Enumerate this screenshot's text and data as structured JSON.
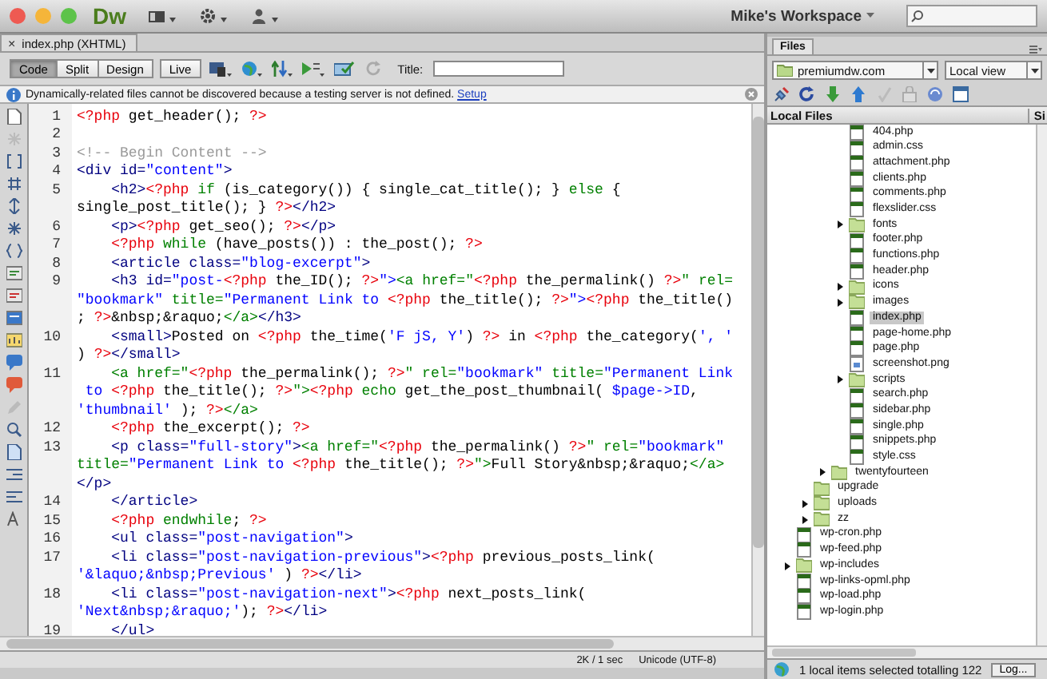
{
  "window": {
    "app_logo": "Dw",
    "workspace": "Mike's Workspace"
  },
  "document_tab": {
    "close": "×",
    "label": "index.php (XHTML)"
  },
  "view_buttons": [
    {
      "label": "Code",
      "selected": true
    },
    {
      "label": "Split",
      "selected": false
    },
    {
      "label": "Design",
      "selected": false
    },
    {
      "label": "Live",
      "selected": false
    }
  ],
  "title_field": {
    "label": "Title:"
  },
  "info_bar": {
    "message": "Dynamically-related files cannot be discovered because a testing server is not defined.",
    "link": "Setup"
  },
  "code": {
    "lines": [
      {
        "number": "1",
        "indent": false,
        "tokens": [
          {
            "kind": "php",
            "text": "<?php"
          },
          {
            "kind": "txt",
            "text": " get_header(); "
          },
          {
            "kind": "php",
            "text": "?>"
          }
        ]
      },
      {
        "number": "2"
      },
      {
        "number": "3",
        "indent": false,
        "tokens": [
          {
            "kind": "cmt",
            "text": "<!-- Begin Content -->"
          }
        ]
      },
      {
        "number": "4",
        "indent": false,
        "tokens": [
          {
            "kind": "tag",
            "text": "<div id="
          },
          {
            "kind": "str",
            "text": "\"content\""
          },
          {
            "kind": "tag",
            "text": ">"
          }
        ]
      },
      {
        "number": "5",
        "indent": true,
        "tokens": [
          {
            "kind": "tag",
            "text": "<h2>"
          },
          {
            "kind": "php",
            "text": "<?php "
          },
          {
            "kind": "kw",
            "text": "if"
          },
          {
            "kind": "txt",
            "text": " (is_category()) { single_cat_title(); } "
          },
          {
            "kind": "kw",
            "text": "else"
          },
          {
            "kind": "txt",
            "text": " {"
          }
        ]
      },
      {
        "indent": false,
        "tokens": [
          {
            "kind": "txt",
            "text": "single_post_title(); } "
          },
          {
            "kind": "php",
            "text": "?>"
          },
          {
            "kind": "tag",
            "text": "</h2>"
          }
        ]
      },
      {
        "number": "6",
        "indent": true,
        "tokens": [
          {
            "kind": "tag",
            "text": "<p>"
          },
          {
            "kind": "php",
            "text": "<?php"
          },
          {
            "kind": "txt",
            "text": " get_seo(); "
          },
          {
            "kind": "php",
            "text": "?>"
          },
          {
            "kind": "tag",
            "text": "</p>"
          }
        ]
      },
      {
        "number": "7",
        "indent": true,
        "tokens": [
          {
            "kind": "php",
            "text": "<?php "
          },
          {
            "kind": "kw",
            "text": "while"
          },
          {
            "kind": "txt",
            "text": " (have_posts()) : the_post(); "
          },
          {
            "kind": "php",
            "text": "?>"
          }
        ]
      },
      {
        "number": "8",
        "indent": true,
        "tokens": [
          {
            "kind": "tag",
            "text": "<article class="
          },
          {
            "kind": "str",
            "text": "\"blog-excerpt\""
          },
          {
            "kind": "tag",
            "text": ">"
          }
        ]
      },
      {
        "number": "9",
        "indent": true,
        "tokens": [
          {
            "kind": "tag",
            "text": "<h3 id="
          },
          {
            "kind": "str",
            "text": "\"post-"
          },
          {
            "kind": "php",
            "text": "<?php"
          },
          {
            "kind": "txt",
            "text": " the_ID(); "
          },
          {
            "kind": "php",
            "text": "?>"
          },
          {
            "kind": "str",
            "text": "\">"
          },
          {
            "kind": "kw",
            "text": "<a href=\""
          },
          {
            "kind": "php",
            "text": "<?php"
          },
          {
            "kind": "txt",
            "text": " the_permalink() "
          },
          {
            "kind": "php",
            "text": "?>"
          },
          {
            "kind": "kw",
            "text": "\" rel="
          }
        ]
      },
      {
        "indent": false,
        "tokens": [
          {
            "kind": "str",
            "text": "\"bookmark\""
          },
          {
            "kind": "kw",
            "text": " title="
          },
          {
            "kind": "str",
            "text": "\"Permanent Link to "
          },
          {
            "kind": "php",
            "text": "<?php"
          },
          {
            "kind": "txt",
            "text": " the_title(); "
          },
          {
            "kind": "php",
            "text": "?>"
          },
          {
            "kind": "str",
            "text": "\">"
          },
          {
            "kind": "php",
            "text": "<?php"
          },
          {
            "kind": "txt",
            "text": " the_title()"
          }
        ]
      },
      {
        "indent": false,
        "tokens": [
          {
            "kind": "txt",
            "text": "; "
          },
          {
            "kind": "php",
            "text": "?>"
          },
          {
            "kind": "txt",
            "text": "&nbsp;&raquo;"
          },
          {
            "kind": "kw",
            "text": "</a>"
          },
          {
            "kind": "tag",
            "text": "</h3>"
          }
        ]
      },
      {
        "number": "10",
        "indent": true,
        "tokens": [
          {
            "kind": "tag",
            "text": "<small>"
          },
          {
            "kind": "txt",
            "text": "Posted on "
          },
          {
            "kind": "php",
            "text": "<?php"
          },
          {
            "kind": "txt",
            "text": " the_time("
          },
          {
            "kind": "str",
            "text": "'F jS, Y'"
          },
          {
            "kind": "txt",
            "text": ") "
          },
          {
            "kind": "php",
            "text": "?>"
          },
          {
            "kind": "txt",
            "text": " in "
          },
          {
            "kind": "php",
            "text": "<?php"
          },
          {
            "kind": "txt",
            "text": " the_category("
          },
          {
            "kind": "str",
            "text": "', '"
          }
        ]
      },
      {
        "indent": false,
        "tokens": [
          {
            "kind": "txt",
            "text": ") "
          },
          {
            "kind": "php",
            "text": "?>"
          },
          {
            "kind": "tag",
            "text": "</small>"
          }
        ]
      },
      {
        "number": "11",
        "indent": true,
        "tokens": [
          {
            "kind": "kw",
            "text": "<a href=\""
          },
          {
            "kind": "php",
            "text": "<?php"
          },
          {
            "kind": "txt",
            "text": " the_permalink(); "
          },
          {
            "kind": "php",
            "text": "?>"
          },
          {
            "kind": "kw",
            "text": "\" rel="
          },
          {
            "kind": "str",
            "text": "\"bookmark\""
          },
          {
            "kind": "kw",
            "text": " title="
          },
          {
            "kind": "str",
            "text": "\"Permanent Link"
          }
        ]
      },
      {
        "indent": false,
        "tokens": [
          {
            "kind": "str",
            "text": " to "
          },
          {
            "kind": "php",
            "text": "<?php"
          },
          {
            "kind": "txt",
            "text": " the_title(); "
          },
          {
            "kind": "php",
            "text": "?>"
          },
          {
            "kind": "kw",
            "text": "\">"
          },
          {
            "kind": "php",
            "text": "<?php "
          },
          {
            "kind": "kw",
            "text": "echo"
          },
          {
            "kind": "txt",
            "text": " get_the_post_thumbnail( "
          },
          {
            "kind": "str",
            "text": "$page->ID"
          },
          {
            "kind": "txt",
            "text": ","
          }
        ]
      },
      {
        "indent": false,
        "tokens": [
          {
            "kind": "str",
            "text": "'thumbnail'"
          },
          {
            "kind": "txt",
            "text": " ); "
          },
          {
            "kind": "php",
            "text": "?>"
          },
          {
            "kind": "kw",
            "text": "</a>"
          }
        ]
      },
      {
        "number": "12",
        "indent": true,
        "tokens": [
          {
            "kind": "php",
            "text": "<?php"
          },
          {
            "kind": "txt",
            "text": " the_excerpt(); "
          },
          {
            "kind": "php",
            "text": "?>"
          }
        ]
      },
      {
        "number": "13",
        "indent": true,
        "tokens": [
          {
            "kind": "tag",
            "text": "<p class="
          },
          {
            "kind": "str",
            "text": "\"full-story\""
          },
          {
            "kind": "tag",
            "text": ">"
          },
          {
            "kind": "kw",
            "text": "<a href=\""
          },
          {
            "kind": "php",
            "text": "<?php"
          },
          {
            "kind": "txt",
            "text": " the_permalink() "
          },
          {
            "kind": "php",
            "text": "?>"
          },
          {
            "kind": "kw",
            "text": "\" rel="
          },
          {
            "kind": "str",
            "text": "\"bookmark\""
          }
        ]
      },
      {
        "indent": false,
        "tokens": [
          {
            "kind": "kw",
            "text": "title="
          },
          {
            "kind": "str",
            "text": "\"Permanent Link to "
          },
          {
            "kind": "php",
            "text": "<?php"
          },
          {
            "kind": "txt",
            "text": " the_title(); "
          },
          {
            "kind": "php",
            "text": "?>"
          },
          {
            "kind": "kw",
            "text": "\">"
          },
          {
            "kind": "txt",
            "text": "Full Story&nbsp;&raquo;"
          },
          {
            "kind": "kw",
            "text": "</a>"
          }
        ]
      },
      {
        "indent": false,
        "tokens": [
          {
            "kind": "tag",
            "text": "</p>"
          }
        ]
      },
      {
        "number": "14",
        "indent": true,
        "tokens": [
          {
            "kind": "tag",
            "text": "</article>"
          }
        ]
      },
      {
        "number": "15",
        "indent": true,
        "tokens": [
          {
            "kind": "php",
            "text": "<?php "
          },
          {
            "kind": "kw",
            "text": "endwhile"
          },
          {
            "kind": "txt",
            "text": "; "
          },
          {
            "kind": "php",
            "text": "?>"
          }
        ]
      },
      {
        "number": "16",
        "indent": true,
        "tokens": [
          {
            "kind": "tag",
            "text": "<ul class="
          },
          {
            "kind": "str",
            "text": "\"post-navigation\""
          },
          {
            "kind": "tag",
            "text": ">"
          }
        ]
      },
      {
        "number": "17",
        "indent": true,
        "tokens": [
          {
            "kind": "tag",
            "text": "<li class="
          },
          {
            "kind": "str",
            "text": "\"post-navigation-previous\""
          },
          {
            "kind": "tag",
            "text": ">"
          },
          {
            "kind": "php",
            "text": "<?php"
          },
          {
            "kind": "txt",
            "text": " previous_posts_link("
          }
        ]
      },
      {
        "indent": false,
        "tokens": [
          {
            "kind": "str",
            "text": "'&laquo;&nbsp;Previous'"
          },
          {
            "kind": "txt",
            "text": " ) "
          },
          {
            "kind": "php",
            "text": "?>"
          },
          {
            "kind": "tag",
            "text": "</li>"
          }
        ]
      },
      {
        "number": "18",
        "indent": true,
        "tokens": [
          {
            "kind": "tag",
            "text": "<li class="
          },
          {
            "kind": "str",
            "text": "\"post-navigation-next\""
          },
          {
            "kind": "tag",
            "text": ">"
          },
          {
            "kind": "php",
            "text": "<?php"
          },
          {
            "kind": "txt",
            "text": " next_posts_link("
          }
        ]
      },
      {
        "indent": false,
        "tokens": [
          {
            "kind": "str",
            "text": "'Next&nbsp;&raquo;'"
          },
          {
            "kind": "txt",
            "text": "); "
          },
          {
            "kind": "php",
            "text": "?>"
          },
          {
            "kind": "tag",
            "text": "</li>"
          }
        ]
      },
      {
        "number": "19",
        "indent": true,
        "tokens": [
          {
            "kind": "tag",
            "text": "</ul>"
          }
        ]
      }
    ]
  },
  "status_bar": {
    "size": "2K / 1 sec",
    "encoding": "Unicode (UTF-8)"
  },
  "files_panel": {
    "tab": "Files",
    "site": "premiumdw.com",
    "view": "Local view",
    "columns": [
      "Local Files",
      "Si"
    ],
    "tree": [
      {
        "children": [
          {
            "children": [
              {
                "children": [
                  {
                    "label": "404.php",
                    "kind": "php",
                    "selected": false
                  },
                  {
                    "label": "admin.css",
                    "kind": "css",
                    "selected": false
                  },
                  {
                    "label": "attachment.php",
                    "kind": "php",
                    "selected": false
                  },
                  {
                    "label": "clients.php",
                    "kind": "php",
                    "selected": false
                  },
                  {
                    "label": "comments.php",
                    "kind": "php",
                    "selected": false
                  },
                  {
                    "label": "flexslider.css",
                    "kind": "css",
                    "selected": false
                  },
                  {
                    "label": "fonts",
                    "kind": "folder",
                    "expanded": false,
                    "selected": false
                  },
                  {
                    "label": "footer.php",
                    "kind": "php",
                    "selected": false
                  },
                  {
                    "label": "functions.php",
                    "kind": "php",
                    "selected": false
                  },
                  {
                    "label": "header.php",
                    "kind": "php",
                    "selected": false
                  },
                  {
                    "label": "icons",
                    "kind": "folder",
                    "expanded": false,
                    "selected": false
                  },
                  {
                    "label": "images",
                    "kind": "folder",
                    "expanded": false,
                    "selected": false
                  },
                  {
                    "label": "index.php",
                    "kind": "php",
                    "selected": true
                  },
                  {
                    "label": "page-home.php",
                    "kind": "php",
                    "selected": false
                  },
                  {
                    "label": "page.php",
                    "kind": "php",
                    "selected": false
                  },
                  {
                    "label": "screenshot.png",
                    "kind": "image",
                    "selected": false
                  },
                  {
                    "label": "scripts",
                    "kind": "folder",
                    "expanded": false,
                    "selected": false
                  },
                  {
                    "label": "search.php",
                    "kind": "php",
                    "selected": false
                  },
                  {
                    "label": "sidebar.php",
                    "kind": "php",
                    "selected": false
                  },
                  {
                    "label": "single.php",
                    "kind": "php",
                    "selected": false
                  },
                  {
                    "label": "snippets.php",
                    "kind": "php",
                    "selected": false
                  },
                  {
                    "label": "style.css",
                    "kind": "css",
                    "selected": false
                  }
                ]
              },
              {
                "label": "twentyfourteen",
                "kind": "folder",
                "expanded": false,
                "selected": false
              }
            ]
          },
          {
            "label": "upgrade",
            "kind": "folder",
            "selected": false
          },
          {
            "label": "uploads",
            "kind": "folder",
            "expanded": false,
            "selected": false
          },
          {
            "label": "zz",
            "kind": "folder",
            "expanded": false,
            "selected": false
          }
        ]
      },
      {
        "label": "wp-cron.php",
        "kind": "php",
        "selected": false
      },
      {
        "label": "wp-feed.php",
        "kind": "php",
        "selected": false
      },
      {
        "label": "wp-includes",
        "kind": "folder",
        "expanded": false,
        "selected": false
      },
      {
        "label": "wp-links-opml.php",
        "kind": "php",
        "selected": false
      },
      {
        "label": "wp-load.php",
        "kind": "php",
        "selected": false
      },
      {
        "label": "wp-login.php",
        "kind": "php",
        "selected": false
      }
    ],
    "status": "1 local items selected totalling 122",
    "log_button": "Log..."
  }
}
